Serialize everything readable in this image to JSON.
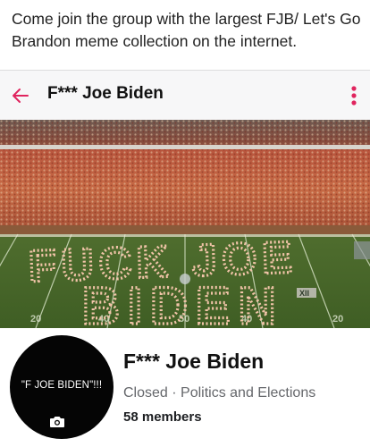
{
  "caption": "Come join the group with the largest FJB/ Let's Go Brandon meme collection on the internet.",
  "header": {
    "title": "F*** Joe Biden",
    "back_icon": "arrow-left-icon",
    "menu_icon": "more-vertical-icon",
    "accent_color": "#e0245e"
  },
  "cover": {
    "description_icon": "stadium-photo",
    "field_text_line1": "FUCK JOE",
    "field_text_line2": "BIDEN",
    "yard_numbers": [
      "20",
      "40",
      "50",
      "40",
      "20"
    ],
    "conference_logo": "XII"
  },
  "avatar": {
    "text": "\"F JOE BIDEN\"!!!",
    "camera_icon": "camera-icon"
  },
  "group": {
    "name": "F*** Joe Biden",
    "privacy": "Closed",
    "separator": " · ",
    "category": "Politics and Elections",
    "member_count": "58",
    "member_label": " members"
  }
}
